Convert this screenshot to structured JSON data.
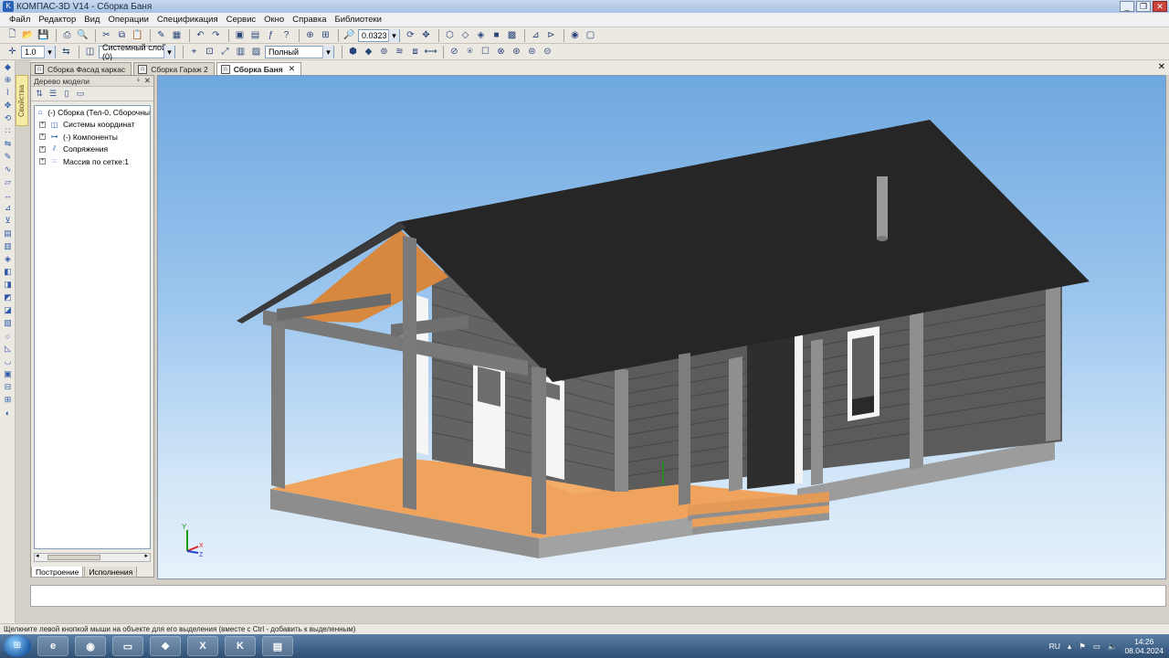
{
  "window": {
    "title": "КОМПАС-3D V14 - Сборка Баня",
    "minimize": "_",
    "restore": "❐",
    "close": "✕"
  },
  "menu": [
    "Файл",
    "Редактор",
    "Вид",
    "Операции",
    "Спецификация",
    "Сервис",
    "Окно",
    "Справка",
    "Библиотеки"
  ],
  "toolbar": {
    "zoom_value": "0.0323",
    "step_value": "1.0",
    "layer_value": "Системный слой (0)",
    "view_mode_value": "Полный"
  },
  "doc_tabs": [
    {
      "label": "Сборка Фасад каркас",
      "active": false
    },
    {
      "label": "Сборка Гараж 2",
      "active": false
    },
    {
      "label": "Сборка Баня",
      "active": true
    }
  ],
  "side_tab": "Свойства",
  "tree_panel": {
    "title": "Дерево модели",
    "items": [
      {
        "label": "(-) Сборка (Тел-0, Сборочны",
        "level": 0
      },
      {
        "label": "Системы координат",
        "level": 1
      },
      {
        "label": "(-) Компоненты",
        "level": 1
      },
      {
        "label": "Сопряжения",
        "level": 1
      },
      {
        "label": "Массив по сетке:1",
        "level": 1
      }
    ],
    "bottom_tabs": [
      "Построение",
      "Исполнения"
    ]
  },
  "axes": {
    "y": "Y",
    "x": "X",
    "z": "Z"
  },
  "status_text": "Щелкните левой кнопкой мыши на объекте для его выделения (вместе с Ctrl - добавить к выделенным)",
  "taskbar": {
    "language": "RU",
    "time": "14:26",
    "date": "08.04.2024"
  },
  "colors": {
    "roof": "#262626",
    "walls": "#5b5b5b",
    "deck": "#f0a35c",
    "foundation": "#9a9a9a",
    "sky_top": "#6fa8e0"
  }
}
